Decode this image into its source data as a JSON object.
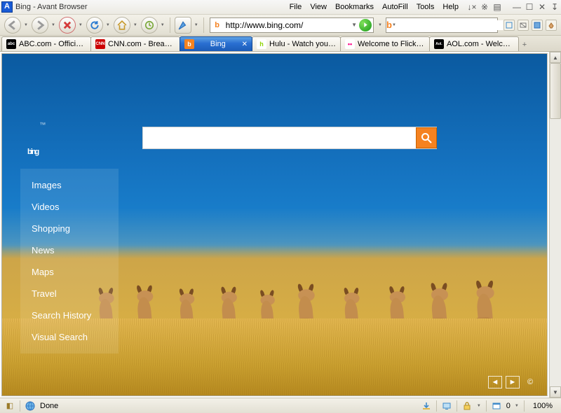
{
  "window": {
    "title": "Bing - Avant Browser"
  },
  "menu": {
    "file": "File",
    "view": "View",
    "bookmarks": "Bookmarks",
    "autofill": "AutoFill",
    "tools": "Tools",
    "help": "Help"
  },
  "toolbar": {
    "url": "http://www.bing.com/",
    "search_engine_glyph": "b",
    "search_value": ""
  },
  "tabs": [
    {
      "label": "ABC.com - Officia…",
      "favicon_bg": "#000",
      "favicon_fg": "#fff",
      "favicon_text": "abc",
      "active": false
    },
    {
      "label": "CNN.com - Breaki…",
      "favicon_bg": "#c00",
      "favicon_fg": "#fff",
      "favicon_text": "CNN",
      "active": false
    },
    {
      "label": "Bing",
      "favicon_bg": "#f58220",
      "favicon_fg": "#fff",
      "favicon_text": "b",
      "active": true
    },
    {
      "label": "Hulu - Watch you…",
      "favicon_bg": "#8fd400",
      "favicon_fg": "#fff",
      "favicon_text": "h",
      "active": false
    },
    {
      "label": "Welcome to Flickr…",
      "favicon_bg": "#fff",
      "favicon_fg": "#ff0084",
      "favicon_text": "••",
      "active": false
    },
    {
      "label": "AOL.com - Welco…",
      "favicon_bg": "#000",
      "favicon_fg": "#fff",
      "favicon_text": "Aol.",
      "active": false
    }
  ],
  "bing": {
    "logo_text": "bing",
    "logo_tm": "™",
    "search_value": "",
    "nav": {
      "images": "Images",
      "videos": "Videos",
      "shopping": "Shopping",
      "news": "News",
      "maps": "Maps",
      "travel": "Travel",
      "history": "Search History",
      "visual": "Visual Search"
    },
    "controls": {
      "prev": "◄",
      "next": "►",
      "info": "©"
    }
  },
  "status": {
    "text": "Done",
    "popup_count": "0",
    "zoom": "100%"
  }
}
